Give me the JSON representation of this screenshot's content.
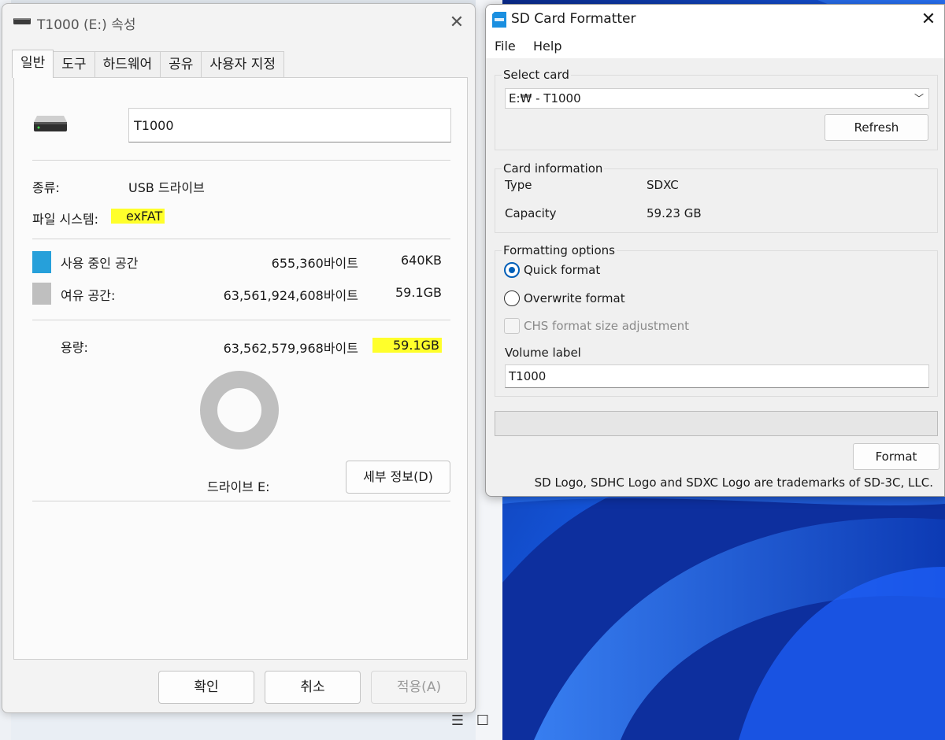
{
  "properties_dialog": {
    "title": "T1000 (E:) 속성",
    "close_glyph": "✕",
    "tabs": [
      "일반",
      "도구",
      "하드웨어",
      "공유",
      "사용자 지정"
    ],
    "active_tab": 0,
    "drive_name": "T1000",
    "type_label": "종류:",
    "type_value": "USB 드라이브",
    "fs_label": "파일 시스템:",
    "fs_value": "exFAT",
    "used_label": "사용 중인 공간",
    "used_bytes": "655,360바이트",
    "used_size": "640KB",
    "free_label": "여유 공간:",
    "free_bytes": "63,561,924,608바이트",
    "free_size": "59.1GB",
    "capacity_label": "용량:",
    "capacity_bytes": "63,562,579,968바이트",
    "capacity_size": "59.1GB",
    "drive_label": "드라이브 E:",
    "details_button": "세부 정보(D)",
    "ok_button": "확인",
    "cancel_button": "취소",
    "apply_button": "적용(A)",
    "used_fraction": 1e-05,
    "colors": {
      "used": "#26a0da",
      "free": "#bfbfbf",
      "highlight": "#ffff2b"
    }
  },
  "sd_formatter": {
    "title": "SD Card Formatter",
    "close_glyph": "✕",
    "menu": [
      "File",
      "Help"
    ],
    "select_card_title": "Select card",
    "selected_card": "E:₩ - T1000",
    "refresh_button": "Refresh",
    "card_info_title": "Card information",
    "type_label": "Type",
    "type_value": "SDXC",
    "capacity_label": "Capacity",
    "capacity_value": "59.23 GB",
    "options_title": "Formatting options",
    "quick_format": "Quick format",
    "overwrite_format": "Overwrite format",
    "chs_adjust": "CHS format size adjustment",
    "volume_label_title": "Volume label",
    "volume_label_value": "T1000",
    "format_button": "Format",
    "trademark": "SD Logo, SDHC Logo and SDXC Logo are trademarks of SD-3C, LLC.",
    "progress": 0,
    "accent": "#005fb8"
  },
  "taskbar": {
    "icons": [
      "list-view-icon",
      "tile-view-icon"
    ]
  }
}
